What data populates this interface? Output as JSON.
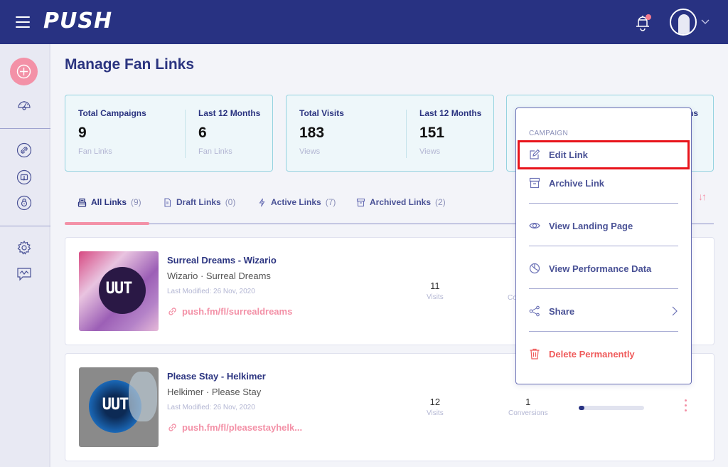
{
  "header": {
    "logo": "PUSH",
    "notifications_badge": true
  },
  "page": {
    "title": "Manage Fan Links"
  },
  "stats": [
    {
      "left": {
        "label": "Total Campaigns",
        "value": "9",
        "unit": "Fan Links"
      },
      "right": {
        "label": "Last 12 Months",
        "value": "6",
        "unit": "Fan Links"
      }
    },
    {
      "left": {
        "label": "Total Visits",
        "value": "183",
        "unit": "Views"
      },
      "right": {
        "label": "Last 12 Months",
        "value": "151",
        "unit": "Views"
      }
    },
    {
      "right_label_visible_fragment": "hs"
    }
  ],
  "tabs": [
    {
      "label": "All Links",
      "count": "(9)",
      "icon": "inbox-icon",
      "active": true
    },
    {
      "label": "Draft Links",
      "count": "(0)",
      "icon": "document-icon",
      "active": false
    },
    {
      "label": "Active Links",
      "count": "(7)",
      "icon": "lightning-icon",
      "active": false
    },
    {
      "label": "Archived Links",
      "count": "(2)",
      "icon": "archive-icon",
      "active": false
    }
  ],
  "links": [
    {
      "title": "Surreal Dreams - Wizario",
      "subtitle": "Wizario · Surreal Dreams",
      "modified": "Last Modified: 26 Nov, 2020",
      "url": "push.fm/fl/surrealdreams",
      "visits": "11",
      "visits_label": "Visits",
      "conversions_label_fragment": "Co"
    },
    {
      "title": "Please Stay - Helkimer",
      "subtitle": "Helkimer · Please Stay",
      "modified": "Last Modified: 26 Nov, 2020",
      "url": "push.fm/fl/pleasestayhelk...",
      "visits": "12",
      "visits_label": "Visits",
      "conversions": "1",
      "conversions_label": "Conversions",
      "conversion_rate": 0.083
    }
  ],
  "cover_text": "UUT",
  "menu": {
    "header": "CAMPAIGN",
    "items": [
      {
        "label": "Edit Link",
        "icon": "edit-icon"
      },
      {
        "label": "Archive Link",
        "icon": "archive-icon"
      },
      {
        "label": "View Landing Page",
        "icon": "eye-icon"
      },
      {
        "label": "View Performance Data",
        "icon": "pie-chart-icon"
      },
      {
        "label": "Share",
        "icon": "share-icon",
        "submenu": true
      },
      {
        "label": "Delete Permanently",
        "icon": "trash-icon",
        "danger": true
      }
    ]
  },
  "colors": {
    "primary": "#283282",
    "accent": "#f391a7",
    "danger": "#ef5a5a",
    "highlight": "#e8141b"
  }
}
